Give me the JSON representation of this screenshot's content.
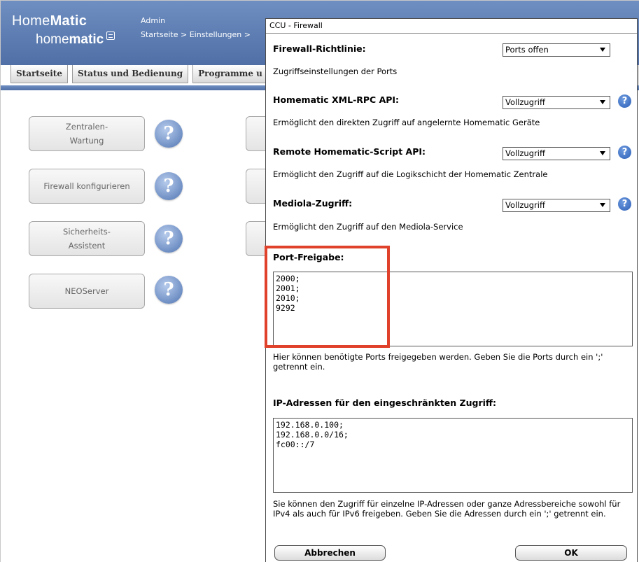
{
  "app": {
    "logo_line1_regular": "Home",
    "logo_line1_bold": "Matic",
    "logo_line2_regular": "home",
    "logo_line2_bold": "matic",
    "logo_mark_icon": "homematic-mark-icon",
    "user": "Admin",
    "breadcrumb": "Startseite > Einstellungen >",
    "tabs": [
      "Startseite",
      "Status und Bedienung",
      "Programme u"
    ]
  },
  "menu": {
    "buttons": [
      "Zentralen-\nWartung",
      "Firewall konfigurieren",
      "Sicherheits-\nAssistent",
      "NEOServer"
    ],
    "help_glyph": "?"
  },
  "dialog": {
    "title": "CCU - Firewall",
    "policy": {
      "label": "Firewall-Richtlinie:",
      "value": "Ports offen",
      "desc": "Zugriffseinstellungen der Ports"
    },
    "xmlrpc": {
      "label": "Homematic XML-RPC API:",
      "value": "Vollzugriff",
      "desc": "Ermöglicht den direkten Zugriff auf angelernte Homematic Geräte"
    },
    "script": {
      "label": "Remote Homematic-Script API:",
      "value": "Vollzugriff",
      "desc": "Ermöglicht den Zugriff auf die Logikschicht der Homematic Zentrale"
    },
    "mediola": {
      "label": "Mediola-Zugriff:",
      "value": "Vollzugriff",
      "desc": "Ermöglicht den Zugriff auf den Mediola-Service"
    },
    "ports": {
      "label": "Port-Freigabe:",
      "value": "2000;\n2001;\n2010;\n9292",
      "desc": "Hier können benötigte Ports freigegeben werden. Geben Sie die Ports durch ein ';' getrennt ein."
    },
    "ip": {
      "label": "IP-Adressen für den eingeschränkten Zugriff:",
      "value": "192.168.0.100;\n192.168.0.0/16;\nfc00::/7",
      "desc": "Sie können den Zugriff für einzelne IP-Adressen oder ganze Adressbereiche sowohl für IPv4 als auch für IPv6 freigeben. Geben Sie die Adressen durch ein ';' getrennt ein."
    },
    "help_glyph": "?",
    "cancel_label": "Abbrechen",
    "ok_label": "OK"
  },
  "colors": {
    "header_blue": "#5a7ab0",
    "highlight_red": "#e0412b",
    "help_blue": "#2c5fb6"
  }
}
